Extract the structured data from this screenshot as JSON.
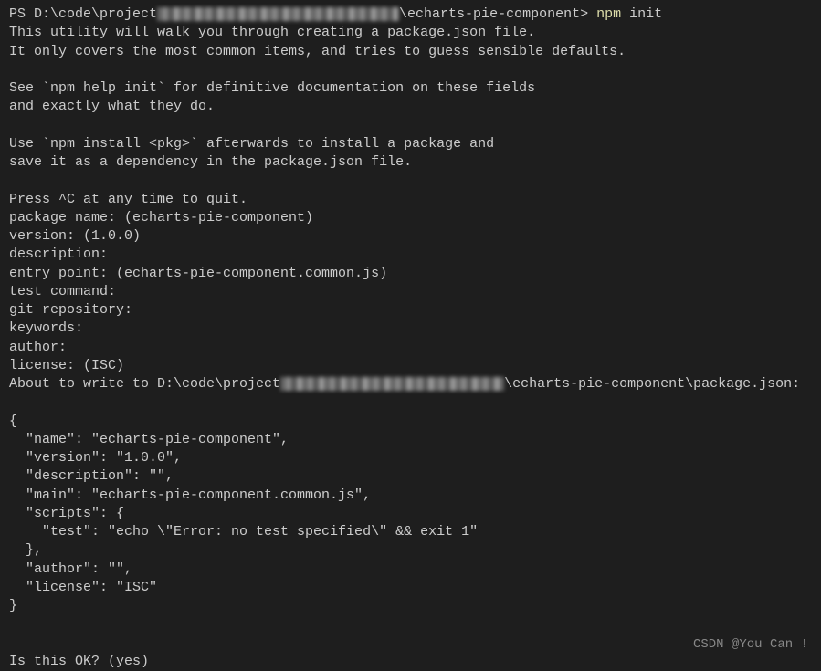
{
  "prompt": {
    "ps": "PS ",
    "pathStart": "D:\\code\\project",
    "pathEnd": "\\echarts-pie-component>",
    "cmd": "npm",
    "cmdArg": "init"
  },
  "intro": {
    "line1": "This utility will walk you through creating a package.json file.",
    "line2": "It only covers the most common items, and tries to guess sensible defaults.",
    "line3": "See `npm help init` for definitive documentation on these fields",
    "line4": "and exactly what they do.",
    "line5": "Use `npm install <pkg>` afterwards to install a package and",
    "line6": "save it as a dependency in the package.json file.",
    "line7": "Press ^C at any time to quit."
  },
  "questions": {
    "packageName": "package name: (echarts-pie-component)",
    "version": "version: (1.0.0)",
    "description": "description:",
    "entryPoint": "entry point: (echarts-pie-component.common.js)",
    "testCommand": "test command:",
    "gitRepository": "git repository:",
    "keywords": "keywords:",
    "author": "author:",
    "license": "license: (ISC)"
  },
  "aboutWrite": {
    "prefix": "About to write to D:\\code\\project",
    "suffix": "\\echarts-pie-component\\package.json:"
  },
  "json": {
    "open": "{",
    "name": "  \"name\": \"echarts-pie-component\",",
    "version": "  \"version\": \"1.0.0\",",
    "description": "  \"description\": \"\",",
    "main": "  \"main\": \"echarts-pie-component.common.js\",",
    "scriptsOpen": "  \"scripts\": {",
    "test": "    \"test\": \"echo \\\"Error: no test specified\\\" && exit 1\"",
    "scriptsClose": "  },",
    "author": "  \"author\": \"\",",
    "license": "  \"license\": \"ISC\"",
    "close": "}"
  },
  "confirm": "Is this OK? (yes)",
  "watermark": "CSDN @You Can !"
}
